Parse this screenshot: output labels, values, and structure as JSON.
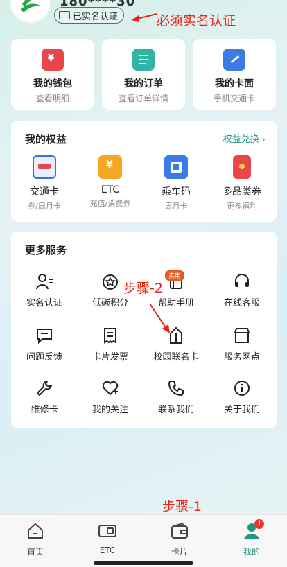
{
  "header": {
    "phone_masked": "180****30",
    "verify_badge": "已实名认证",
    "note": "必须实名认证"
  },
  "top_cards": [
    {
      "title": "我的钱包",
      "sub": "查看明细",
      "icon": "wallet-icon",
      "color": "#e8464a"
    },
    {
      "title": "我的订单",
      "sub": "查看订单详情",
      "icon": "order-icon",
      "color": "#2fb5a3"
    },
    {
      "title": "我的卡面",
      "sub": "手机交通卡",
      "icon": "card-face-icon",
      "color": "#3b7be3"
    }
  ],
  "benefits": {
    "title": "我的权益",
    "link": "权益兑换",
    "items": [
      {
        "label": "交通卡",
        "sub": "券/周月卡",
        "icon": "transit-card-icon"
      },
      {
        "label": "ETC",
        "sub": "充值/消费券",
        "icon": "etc-icon"
      },
      {
        "label": "乘车码",
        "sub": "周月卡",
        "icon": "ride-code-icon"
      },
      {
        "label": "多品类券",
        "sub": "更多福利",
        "icon": "coupon-icon"
      }
    ]
  },
  "services": {
    "title": "更多服务",
    "new_tag": "实用",
    "items": [
      {
        "label": "实名认证",
        "icon": "user-verify-icon"
      },
      {
        "label": "低碳积分",
        "icon": "low-carbon-icon"
      },
      {
        "label": "帮助手册",
        "icon": "help-manual-icon"
      },
      {
        "label": "在线客服",
        "icon": "headset-icon"
      },
      {
        "label": "问题反馈",
        "icon": "feedback-icon"
      },
      {
        "label": "卡片发票",
        "icon": "invoice-icon"
      },
      {
        "label": "校园联名卡",
        "icon": "campus-card-icon"
      },
      {
        "label": "服务网点",
        "icon": "store-icon"
      },
      {
        "label": "维修卡",
        "icon": "wrench-icon"
      },
      {
        "label": "我的关注",
        "icon": "heart-plus-icon"
      },
      {
        "label": "联系我们",
        "icon": "phone-icon"
      },
      {
        "label": "关于我们",
        "icon": "info-icon"
      }
    ]
  },
  "annotations": {
    "step2": "步骤-2",
    "step1": "步骤-1"
  },
  "tabbar": {
    "items": [
      {
        "label": "首页",
        "icon": "home-icon"
      },
      {
        "label": "ETC",
        "icon": "etc-tab-icon"
      },
      {
        "label": "卡片",
        "icon": "wallet-tab-icon"
      },
      {
        "label": "我的",
        "icon": "profile-icon",
        "active": true
      }
    ],
    "badge": "!"
  },
  "colors": {
    "accent": "#1d9a7e",
    "annotation": "#e82515"
  }
}
